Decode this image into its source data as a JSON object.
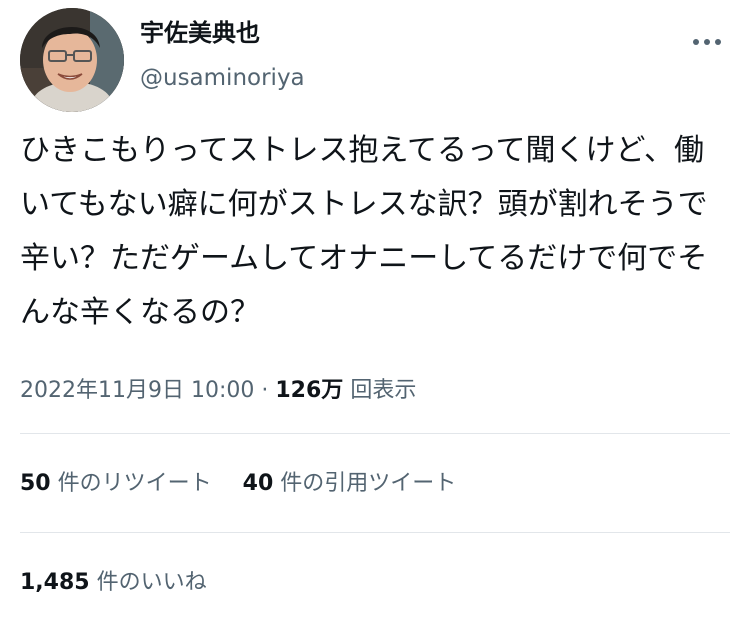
{
  "user": {
    "display_name": "宇佐美典也",
    "handle": "@usaminoriya"
  },
  "more_icon": "more-horizontal-icon",
  "tweet": {
    "text": "ひきこもりってストレス抱えてるって聞くけど、働いてもない癖に何がストレスな訳？頭が割れそうで辛い？ただゲームしてオナニーしてるだけで何でそんな辛くなるの？"
  },
  "meta": {
    "timestamp": "2022年11月9日 10:00",
    "separator": "·",
    "views": "126万",
    "views_label": "回表示"
  },
  "stats": {
    "retweets": "50",
    "retweets_label": "件のリツイート",
    "quotes": "40",
    "quotes_label": "件の引用ツイート",
    "likes": "1,485",
    "likes_label": "件のいいね"
  },
  "colors": {
    "text": "#0f1419",
    "secondary": "#536471",
    "divider": "#e2e6ea"
  }
}
